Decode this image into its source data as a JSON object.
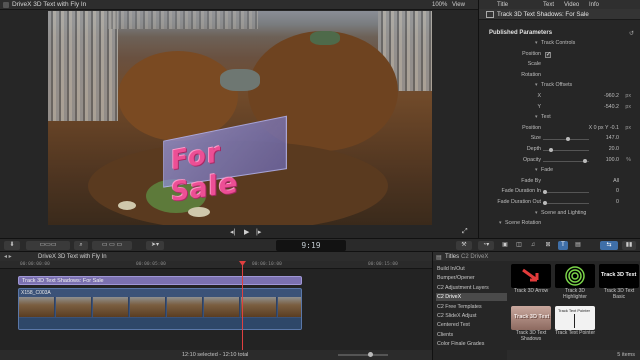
{
  "viewer": {
    "window_title": "DriveX 3D Text with Fly In",
    "zoom": "100%",
    "view_menu": "View",
    "overlay_text": "For Sale"
  },
  "inspector": {
    "tabs": [
      "Title",
      "Text",
      "Video",
      "Info"
    ],
    "title": "Track 3D Text Shadows: For Sale",
    "section": "Published Parameters",
    "rows": [
      {
        "label": "Track Controls",
        "value": "",
        "unit": "",
        "kind": "group"
      },
      {
        "label": "Position",
        "value": "",
        "unit": "",
        "kind": "check"
      },
      {
        "label": "Scale",
        "value": "",
        "unit": "",
        "kind": "plain"
      },
      {
        "label": "Rotation",
        "value": "",
        "unit": "",
        "kind": "plain"
      },
      {
        "label": "Track Offsets",
        "value": "",
        "unit": "",
        "kind": "group"
      },
      {
        "label": "X",
        "value": "-960.2",
        "unit": "px",
        "kind": "value"
      },
      {
        "label": "Y",
        "value": "-540.2",
        "unit": "px",
        "kind": "value"
      },
      {
        "label": "Text",
        "value": "",
        "unit": "",
        "kind": "group"
      },
      {
        "label": "Position",
        "value": "X  0 px   Y  -0.1",
        "unit": "px",
        "kind": "value"
      },
      {
        "label": "Size",
        "value": "147.0",
        "unit": "",
        "kind": "slider",
        "level": 0.55
      },
      {
        "label": "Depth",
        "value": "20.0",
        "unit": "",
        "kind": "slider",
        "level": 0.15
      },
      {
        "label": "Opacity",
        "value": "100.0",
        "unit": "%",
        "kind": "slider",
        "level": 0.95
      },
      {
        "label": "Fade",
        "value": "",
        "unit": "",
        "kind": "group"
      },
      {
        "label": "Fade By",
        "value": "All",
        "unit": "",
        "kind": "value"
      },
      {
        "label": "Fade Duration In",
        "value": "0",
        "unit": "",
        "kind": "slider",
        "level": 0.0
      },
      {
        "label": "Fade Duration Out",
        "value": "0",
        "unit": "",
        "kind": "slider",
        "level": 0.0
      },
      {
        "label": "Scene and Lighting",
        "value": "",
        "unit": "",
        "kind": "group"
      },
      {
        "label": "Scene Rotation",
        "value": "",
        "unit": "",
        "kind": "group-left"
      }
    ]
  },
  "toolbar": {
    "timecode": "9:19"
  },
  "timeline": {
    "title": "DriveX 3D Text with Fly In",
    "ruler": [
      "00:00:00:00",
      "00:00:05:00",
      "00:00:10:00",
      "00:00:15:00"
    ],
    "title_clip": "Track 3D Text Shadows: For Sale",
    "video_clip": "X158_C003A",
    "selection": "12:10 selected - 12:10 total"
  },
  "browser": {
    "title": "Titles",
    "crumb": "C2 DriveX",
    "categories": [
      "Build In/Out",
      "Bumper/Opener",
      "C2 Adjustment Layers",
      "C2 DriveX",
      "C2 Free Templates",
      "C2 SlideX Adjust",
      "Centered Text",
      "Clients",
      "Color Finale Grades"
    ],
    "selected_category": 3,
    "tiles": [
      {
        "label": "Track 3D Arrow",
        "art": "arrow"
      },
      {
        "label": "Track 3D Highlighter",
        "art": "rings"
      },
      {
        "label": "Track 3D Text Basic",
        "art": "text",
        "art_text": "Track 3D Text"
      },
      {
        "label": "Track 3D Text Shadows",
        "art": "shadow",
        "art_text": "Track 3D Text"
      },
      {
        "label": "Track Text Pointer",
        "art": "pointer",
        "art_text": "Track Text Pointer"
      }
    ],
    "count": "5 items"
  }
}
